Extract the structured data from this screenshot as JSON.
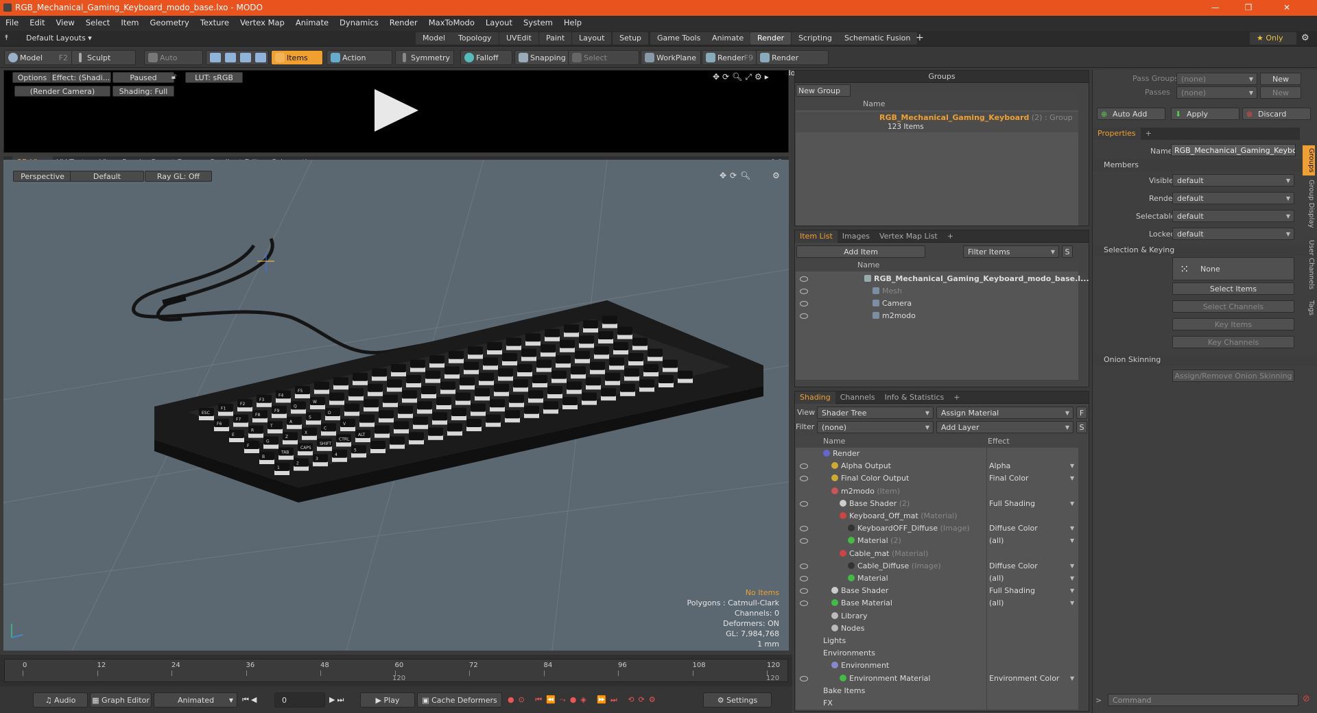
{
  "window": {
    "title": "RGB_Mechanical_Gaming_Keyboard_modo_base.lxo - MODO",
    "min": "—",
    "max": "❐",
    "close": "✕"
  },
  "menu": [
    "File",
    "Edit",
    "View",
    "Select",
    "Item",
    "Geometry",
    "Texture",
    "Vertex Map",
    "Animate",
    "Dynamics",
    "Render",
    "MaxToModo",
    "Layout",
    "System",
    "Help"
  ],
  "layout": {
    "preset": "Default Layouts ▾",
    "tabs": [
      "Model",
      "Topology",
      "UVEdit",
      "Paint",
      "Layout",
      "Setup",
      "Game Tools",
      "Animate",
      "Render",
      "Scripting",
      "Schematic Fusion"
    ],
    "active": "Render",
    "plus": "+",
    "only": "★  Only",
    "gear": "⚙"
  },
  "toolbar": {
    "model": "Model",
    "model_key": "F2",
    "sculpt": "Sculpt",
    "auto_select": "Auto Select",
    "items": "Items",
    "action_center": "Action Center",
    "symmetry": "Symmetry",
    "falloff": "Falloff",
    "snapping": "Snapping",
    "select_through": "Select Through",
    "workplane": "WorkPlane",
    "render": "Render",
    "render_key": "F9",
    "render_window": "Render Window"
  },
  "preview": {
    "options": "Options",
    "effect": "Effect: (Shadi...",
    "paused": "Paused",
    "lut": "LUT: sRGB",
    "camera": "(Render Camera)",
    "shading": "Shading: Full",
    "play": "▶"
  },
  "viewtabs": {
    "tabs": [
      "3D View",
      "UV Texture View",
      "Render Preset Browser",
      "Gradient Editor",
      "Schematic"
    ],
    "plus": "+"
  },
  "viewport": {
    "perspective": "Perspective",
    "default": "Default",
    "raygl": "Ray GL: Off",
    "info": {
      "items": "No Items",
      "polygons": "Polygons : Catmull-Clark",
      "channels": "Channels: 0",
      "deformers": "Deformers: ON",
      "gl": "GL: 7,984,768",
      "scale": "1 mm"
    }
  },
  "keyboard": {
    "keys": [
      "ESC",
      "F1",
      "F2",
      "F3",
      "F4",
      "F5",
      "F6",
      "F7",
      "F8",
      "F9",
      "Q",
      "W",
      "E",
      "R",
      "T",
      "A",
      "S",
      "D",
      "F",
      "G",
      "Z",
      "X",
      "C",
      "V",
      "B",
      "TAB",
      "CAPS",
      "SHIFT",
      "CTRL",
      "ALT",
      "1",
      "2",
      "3",
      "4",
      "5"
    ]
  },
  "timeline": {
    "ticks": [
      "0",
      "12",
      "24",
      "36",
      "48",
      "60",
      "72",
      "84",
      "96",
      "108",
      "120"
    ],
    "sub_mid": "120",
    "sub_end": "120"
  },
  "bottom": {
    "audio": "Audio",
    "graph_editor": "Graph Editor",
    "animated": "Animated",
    "frame": "0",
    "play": "Play",
    "cache": "Cache Deformers",
    "settings": "Settings"
  },
  "groups": {
    "title": "Groups",
    "new_group": "New Group",
    "col_name": "Name",
    "item_name": "RGB_Mechanical_Gaming_Keyboard",
    "item_suffix": "(2) : Group",
    "item_count": "123 Items"
  },
  "itemlist": {
    "tabs": [
      "Item List",
      "Images",
      "Vertex Map List"
    ],
    "plus": "+",
    "add_item": "Add Item",
    "filter": "Filter Items",
    "s": "S",
    "col_name": "Name",
    "rows": [
      {
        "name": "RGB_Mechanical_Gaming_Keyboard_modo_base.l...",
        "indent": 0
      },
      {
        "name": "Mesh",
        "indent": 1
      },
      {
        "name": "Camera",
        "indent": 1
      },
      {
        "name": "m2modo",
        "indent": 1
      }
    ]
  },
  "shading": {
    "tabs": [
      "Shading",
      "Channels",
      "Info & Statistics"
    ],
    "plus": "+",
    "view_label": "View",
    "view_value": "Shader Tree",
    "assign": "Assign Material",
    "f": "F",
    "filter_label": "Filter",
    "filter_value": "(none)",
    "add_layer": "Add Layer",
    "s": "S",
    "col_name": "Name",
    "col_effect": "Effect",
    "rows": [
      {
        "name": "Render",
        "tag": "",
        "effect": "",
        "indent": 0
      },
      {
        "name": "Alpha Output",
        "tag": "",
        "effect": "Alpha",
        "indent": 1
      },
      {
        "name": "Final Color Output",
        "tag": "",
        "effect": "Final Color",
        "indent": 1
      },
      {
        "name": "m2modo",
        "tag": "(Item)",
        "effect": "",
        "indent": 1
      },
      {
        "name": "Base Shader",
        "tag": "(2)",
        "effect": "Full Shading",
        "indent": 2
      },
      {
        "name": "Keyboard_Off_mat",
        "tag": "(Material)",
        "effect": "",
        "indent": 2
      },
      {
        "name": "KeyboardOFF_Diffuse",
        "tag": "(Image)",
        "effect": "Diffuse Color",
        "indent": 3
      },
      {
        "name": "Material",
        "tag": "(2)",
        "effect": "(all)",
        "indent": 3
      },
      {
        "name": "Cable_mat",
        "tag": "(Material)",
        "effect": "",
        "indent": 2
      },
      {
        "name": "Cable_Diffuse",
        "tag": "(Image)",
        "effect": "Diffuse Color",
        "indent": 3
      },
      {
        "name": "Material",
        "tag": "",
        "effect": "(all)",
        "indent": 3
      },
      {
        "name": "Base Shader",
        "tag": "",
        "effect": "Full Shading",
        "indent": 1
      },
      {
        "name": "Base Material",
        "tag": "",
        "effect": "(all)",
        "indent": 1
      },
      {
        "name": "Library",
        "tag": "",
        "effect": "",
        "indent": 1
      },
      {
        "name": "Nodes",
        "tag": "",
        "effect": "",
        "indent": 1
      },
      {
        "name": "Lights",
        "tag": "",
        "effect": "",
        "indent": 0
      },
      {
        "name": "Environments",
        "tag": "",
        "effect": "",
        "indent": 0
      },
      {
        "name": "Environment",
        "tag": "",
        "effect": "",
        "indent": 1
      },
      {
        "name": "Environment Material",
        "tag": "",
        "effect": "Environment Color",
        "indent": 2
      },
      {
        "name": "Bake Items",
        "tag": "",
        "effect": "",
        "indent": 0
      },
      {
        "name": "FX",
        "tag": "",
        "effect": "",
        "indent": 0
      }
    ]
  },
  "right": {
    "pass_groups": "Pass Groups",
    "passes": "Passes",
    "none": "(none)",
    "new": "New",
    "auto_add": "Auto Add",
    "apply": "Apply",
    "discard": "Discard",
    "properties": "Properties",
    "plus": "+",
    "name_label": "Name",
    "name_value": "RGB_Mechanical_Gaming_Keyboard",
    "members": "Members",
    "visible": "Visible",
    "render": "Render",
    "selectable": "Selectable",
    "locked": "Locked",
    "default": "default",
    "selkey": "Selection & Keying",
    "none_btn": "None",
    "select_items": "Select Items",
    "select_channels": "Select Channels",
    "key_items": "Key Items",
    "key_channels": "Key Channels",
    "onion": "Onion Skinning",
    "assign_onion": "Assign/Remove Onion Skinning",
    "side_tabs": [
      "Groups",
      "Group Display",
      "User Channels",
      "Tags"
    ],
    "command": "Command"
  }
}
